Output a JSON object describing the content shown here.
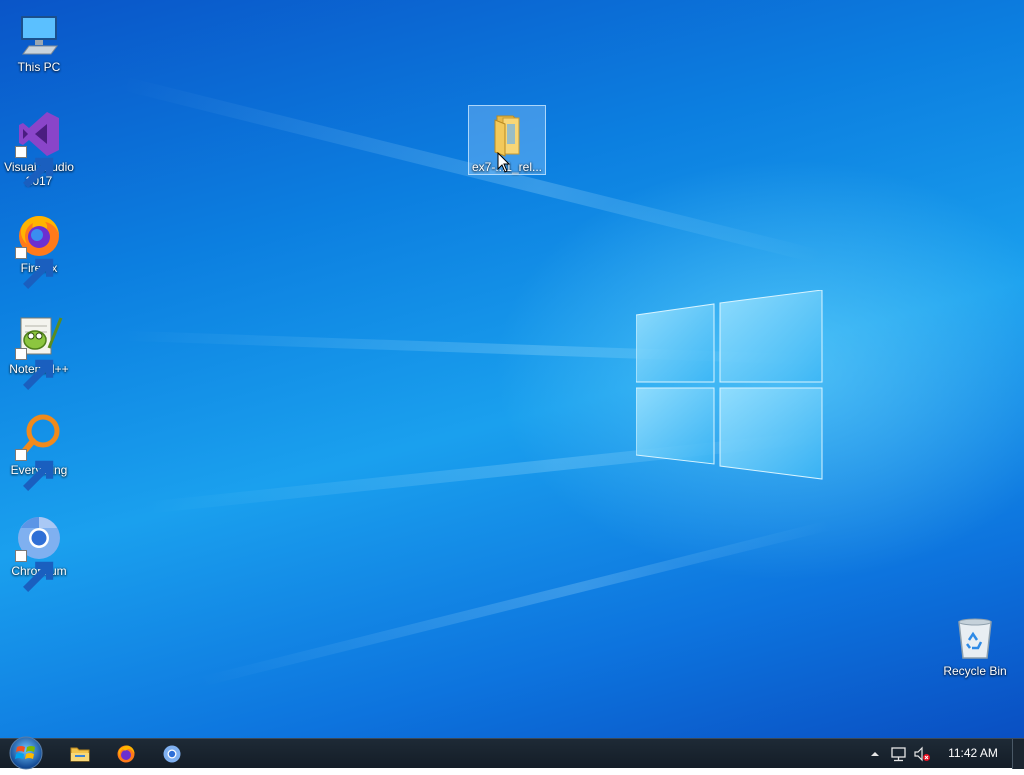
{
  "desktop": {
    "icons": [
      {
        "label": "This PC",
        "icon": "computer-icon"
      },
      {
        "label": "Visual Studio 2017",
        "icon": "visual-studio-icon"
      },
      {
        "label": "Firefox",
        "icon": "firefox-icon"
      },
      {
        "label": "Notepad++",
        "icon": "notepad-plus-plus-icon"
      },
      {
        "label": "Everything",
        "icon": "everything-search-icon"
      },
      {
        "label": "Chromium",
        "icon": "chromium-icon"
      }
    ],
    "selected_folder": {
      "label": "ex7-...1_rel...",
      "icon": "folder-icon"
    },
    "recycle_bin": {
      "label": "Recycle Bin",
      "icon": "recycle-bin-icon"
    }
  },
  "taskbar": {
    "start_icon": "windows-start-orb-icon",
    "pinned": [
      {
        "name": "File Explorer",
        "icon": "folder-icon"
      },
      {
        "name": "Firefox",
        "icon": "firefox-icon"
      },
      {
        "name": "Chromium",
        "icon": "chromium-icon"
      }
    ],
    "tray": {
      "overflow_icon": "chevron-up-icon",
      "network_icon": "network-icon",
      "volume_icon": "volume-muted-icon",
      "clock": "11:42 AM"
    }
  },
  "colors": {
    "desktop_blue": "#0c7fe0",
    "taskbar": "#1a2430",
    "accent_light": "#8fd6ff"
  }
}
